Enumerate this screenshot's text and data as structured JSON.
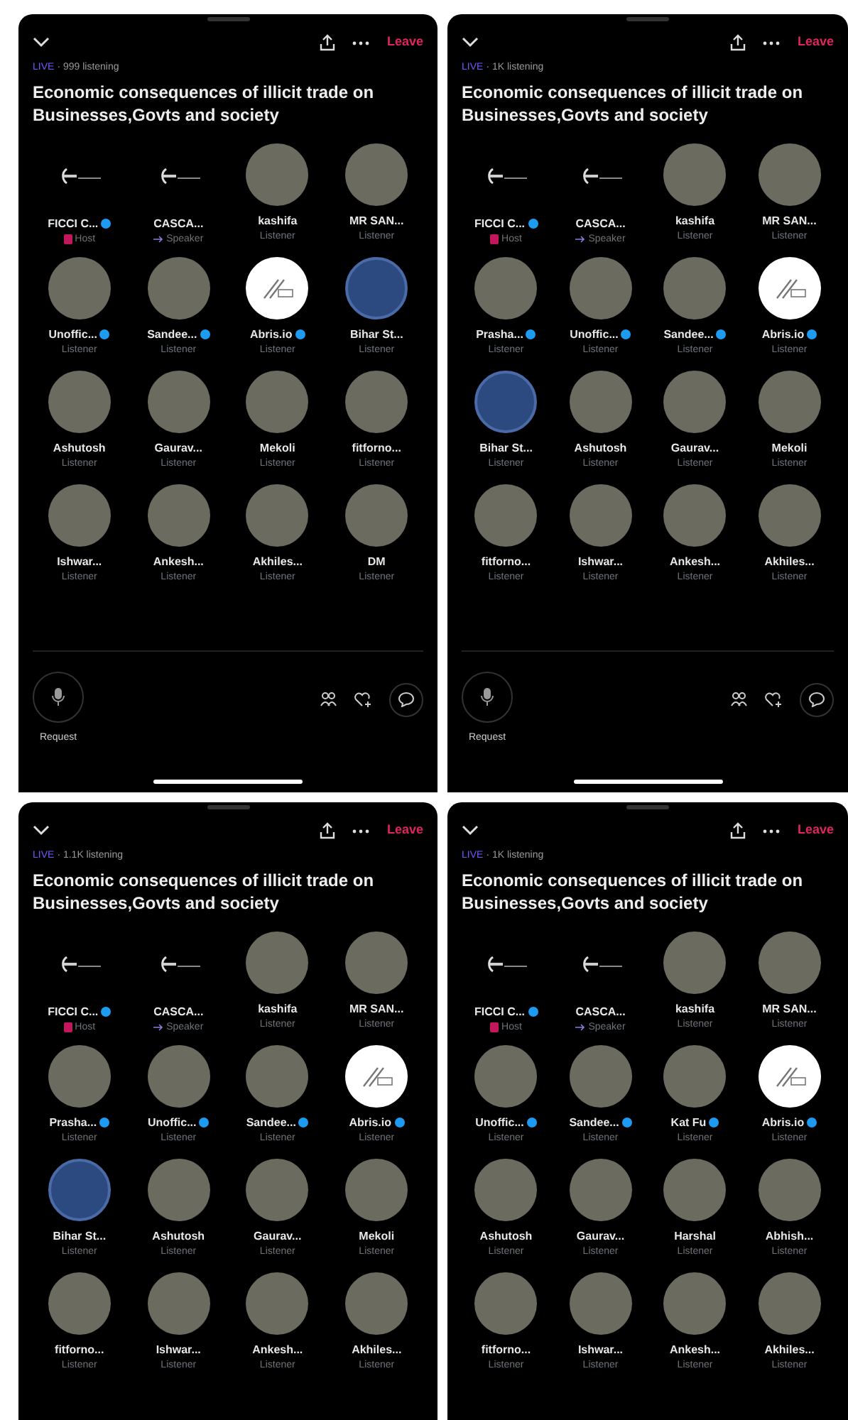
{
  "panels": [
    {
      "live": "LIVE",
      "listening": "· 999 listening",
      "leave": "Leave",
      "title": "Economic consequences of illicit trade on Businesses,Govts and society",
      "footer": {
        "request": "Request"
      },
      "participants": [
        {
          "name": "FICCI C...",
          "verified": true,
          "role": {
            "text": "Host",
            "kind": "host"
          },
          "kind": "logo"
        },
        {
          "name": "CASCA...",
          "verified": false,
          "role": {
            "text": "Speaker",
            "kind": "speaker"
          },
          "kind": "logo"
        },
        {
          "name": "kashifa",
          "verified": false,
          "role": {
            "text": "Listener",
            "kind": "listener"
          },
          "kind": "photo"
        },
        {
          "name": "MR SAN...",
          "verified": false,
          "role": {
            "text": "Listener",
            "kind": "listener"
          },
          "kind": "photo"
        },
        {
          "name": "Unoffic...",
          "verified": true,
          "role": {
            "text": "Listener",
            "kind": "listener"
          },
          "kind": "photo"
        },
        {
          "name": "Sandee...",
          "verified": true,
          "role": {
            "text": "Listener",
            "kind": "listener"
          },
          "kind": "photo"
        },
        {
          "name": "Abris.io",
          "verified": true,
          "role": {
            "text": "Listener",
            "kind": "listener"
          },
          "kind": "emblem"
        },
        {
          "name": "Bihar St...",
          "verified": false,
          "role": {
            "text": "Listener",
            "kind": "listener"
          },
          "kind": "globe"
        },
        {
          "name": "Ashutosh",
          "verified": false,
          "role": {
            "text": "Listener",
            "kind": "listener"
          },
          "kind": "photo"
        },
        {
          "name": "Gaurav...",
          "verified": false,
          "role": {
            "text": "Listener",
            "kind": "listener"
          },
          "kind": "photo"
        },
        {
          "name": "Mekoli",
          "verified": false,
          "role": {
            "text": "Listener",
            "kind": "listener"
          },
          "kind": "photo"
        },
        {
          "name": "fitforno...",
          "verified": false,
          "role": {
            "text": "Listener",
            "kind": "listener"
          },
          "kind": "photo"
        },
        {
          "name": "Ishwar...",
          "verified": false,
          "role": {
            "text": "Listener",
            "kind": "listener"
          },
          "kind": "photo"
        },
        {
          "name": "Ankesh...",
          "verified": false,
          "role": {
            "text": "Listener",
            "kind": "listener"
          },
          "kind": "photo"
        },
        {
          "name": "Akhiles...",
          "verified": false,
          "role": {
            "text": "Listener",
            "kind": "listener"
          },
          "kind": "photo"
        },
        {
          "name": "DM",
          "verified": false,
          "role": {
            "text": "Listener",
            "kind": "listener"
          },
          "kind": "photo"
        }
      ]
    },
    {
      "live": "LIVE",
      "listening": "· 1K listening",
      "leave": "Leave",
      "title": "Economic consequences of illicit trade on Businesses,Govts and society",
      "footer": {
        "request": "Request"
      },
      "participants": [
        {
          "name": "FICCI C...",
          "verified": true,
          "role": {
            "text": "Host",
            "kind": "host"
          },
          "kind": "logo"
        },
        {
          "name": "CASCA...",
          "verified": false,
          "role": {
            "text": "Speaker",
            "kind": "speaker"
          },
          "kind": "logo"
        },
        {
          "name": "kashifa",
          "verified": false,
          "role": {
            "text": "Listener",
            "kind": "listener"
          },
          "kind": "photo"
        },
        {
          "name": "MR SAN...",
          "verified": false,
          "role": {
            "text": "Listener",
            "kind": "listener"
          },
          "kind": "photo"
        },
        {
          "name": "Prasha...",
          "verified": true,
          "role": {
            "text": "Listener",
            "kind": "listener"
          },
          "kind": "photo"
        },
        {
          "name": "Unoffic...",
          "verified": true,
          "role": {
            "text": "Listener",
            "kind": "listener"
          },
          "kind": "photo"
        },
        {
          "name": "Sandee...",
          "verified": true,
          "role": {
            "text": "Listener",
            "kind": "listener"
          },
          "kind": "photo"
        },
        {
          "name": "Abris.io",
          "verified": true,
          "role": {
            "text": "Listener",
            "kind": "listener"
          },
          "kind": "emblem"
        },
        {
          "name": "Bihar St...",
          "verified": false,
          "role": {
            "text": "Listener",
            "kind": "listener"
          },
          "kind": "globe"
        },
        {
          "name": "Ashutosh",
          "verified": false,
          "role": {
            "text": "Listener",
            "kind": "listener"
          },
          "kind": "photo"
        },
        {
          "name": "Gaurav...",
          "verified": false,
          "role": {
            "text": "Listener",
            "kind": "listener"
          },
          "kind": "photo"
        },
        {
          "name": "Mekoli",
          "verified": false,
          "role": {
            "text": "Listener",
            "kind": "listener"
          },
          "kind": "photo"
        },
        {
          "name": "fitforno...",
          "verified": false,
          "role": {
            "text": "Listener",
            "kind": "listener"
          },
          "kind": "photo"
        },
        {
          "name": "Ishwar...",
          "verified": false,
          "role": {
            "text": "Listener",
            "kind": "listener"
          },
          "kind": "photo"
        },
        {
          "name": "Ankesh...",
          "verified": false,
          "role": {
            "text": "Listener",
            "kind": "listener"
          },
          "kind": "photo"
        },
        {
          "name": "Akhiles...",
          "verified": false,
          "role": {
            "text": "Listener",
            "kind": "listener"
          },
          "kind": "photo"
        }
      ]
    },
    {
      "live": "LIVE",
      "listening": "· 1.1K listening",
      "leave": "Leave",
      "title": "Economic consequences of illicit trade on Businesses,Govts and society",
      "participants": [
        {
          "name": "FICCI C...",
          "verified": true,
          "role": {
            "text": "Host",
            "kind": "host"
          },
          "kind": "logo"
        },
        {
          "name": "CASCA...",
          "verified": false,
          "role": {
            "text": "Speaker",
            "kind": "speaker"
          },
          "kind": "logo"
        },
        {
          "name": "kashifa",
          "verified": false,
          "role": {
            "text": "Listener",
            "kind": "listener"
          },
          "kind": "photo"
        },
        {
          "name": "MR SAN...",
          "verified": false,
          "role": {
            "text": "Listener",
            "kind": "listener"
          },
          "kind": "photo"
        },
        {
          "name": "Prasha...",
          "verified": true,
          "role": {
            "text": "Listener",
            "kind": "listener"
          },
          "kind": "photo"
        },
        {
          "name": "Unoffic...",
          "verified": true,
          "role": {
            "text": "Listener",
            "kind": "listener"
          },
          "kind": "photo"
        },
        {
          "name": "Sandee...",
          "verified": true,
          "role": {
            "text": "Listener",
            "kind": "listener"
          },
          "kind": "photo"
        },
        {
          "name": "Abris.io",
          "verified": true,
          "role": {
            "text": "Listener",
            "kind": "listener"
          },
          "kind": "emblem"
        },
        {
          "name": "Bihar St...",
          "verified": false,
          "role": {
            "text": "Listener",
            "kind": "listener"
          },
          "kind": "globe"
        },
        {
          "name": "Ashutosh",
          "verified": false,
          "role": {
            "text": "Listener",
            "kind": "listener"
          },
          "kind": "photo"
        },
        {
          "name": "Gaurav...",
          "verified": false,
          "role": {
            "text": "Listener",
            "kind": "listener"
          },
          "kind": "photo"
        },
        {
          "name": "Mekoli",
          "verified": false,
          "role": {
            "text": "Listener",
            "kind": "listener"
          },
          "kind": "photo"
        },
        {
          "name": "fitforno...",
          "verified": false,
          "role": {
            "text": "Listener",
            "kind": "listener"
          },
          "kind": "photo"
        },
        {
          "name": "Ishwar...",
          "verified": false,
          "role": {
            "text": "Listener",
            "kind": "listener"
          },
          "kind": "photo"
        },
        {
          "name": "Ankesh...",
          "verified": false,
          "role": {
            "text": "Listener",
            "kind": "listener"
          },
          "kind": "photo"
        },
        {
          "name": "Akhiles...",
          "verified": false,
          "role": {
            "text": "Listener",
            "kind": "listener"
          },
          "kind": "photo"
        }
      ]
    },
    {
      "live": "LIVE",
      "listening": "· 1K listening",
      "leave": "Leave",
      "title": "Economic consequences of illicit trade on Businesses,Govts and society",
      "participants": [
        {
          "name": "FICCI C...",
          "verified": true,
          "role": {
            "text": "Host",
            "kind": "host"
          },
          "kind": "logo"
        },
        {
          "name": "CASCA...",
          "verified": false,
          "role": {
            "text": "Speaker",
            "kind": "speaker"
          },
          "kind": "logo"
        },
        {
          "name": "kashifa",
          "verified": false,
          "role": {
            "text": "Listener",
            "kind": "listener"
          },
          "kind": "photo"
        },
        {
          "name": "MR SAN...",
          "verified": false,
          "role": {
            "text": "Listener",
            "kind": "listener"
          },
          "kind": "photo"
        },
        {
          "name": "Unoffic...",
          "verified": true,
          "role": {
            "text": "Listener",
            "kind": "listener"
          },
          "kind": "photo"
        },
        {
          "name": "Sandee...",
          "verified": true,
          "role": {
            "text": "Listener",
            "kind": "listener"
          },
          "kind": "photo"
        },
        {
          "name": "Kat Fu",
          "verified": true,
          "role": {
            "text": "Listener",
            "kind": "listener"
          },
          "kind": "photo"
        },
        {
          "name": "Abris.io",
          "verified": true,
          "role": {
            "text": "Listener",
            "kind": "listener"
          },
          "kind": "emblem"
        },
        {
          "name": "Ashutosh",
          "verified": false,
          "role": {
            "text": "Listener",
            "kind": "listener"
          },
          "kind": "photo"
        },
        {
          "name": "Gaurav...",
          "verified": false,
          "role": {
            "text": "Listener",
            "kind": "listener"
          },
          "kind": "photo"
        },
        {
          "name": "Harshal",
          "verified": false,
          "role": {
            "text": "Listener",
            "kind": "listener"
          },
          "kind": "photo"
        },
        {
          "name": "Abhish...",
          "verified": false,
          "role": {
            "text": "Listener",
            "kind": "listener"
          },
          "kind": "photo"
        },
        {
          "name": "fitforno...",
          "verified": false,
          "role": {
            "text": "Listener",
            "kind": "listener"
          },
          "kind": "photo"
        },
        {
          "name": "Ishwar...",
          "verified": false,
          "role": {
            "text": "Listener",
            "kind": "listener"
          },
          "kind": "photo"
        },
        {
          "name": "Ankesh...",
          "verified": false,
          "role": {
            "text": "Listener",
            "kind": "listener"
          },
          "kind": "photo"
        },
        {
          "name": "Akhiles...",
          "verified": false,
          "role": {
            "text": "Listener",
            "kind": "listener"
          },
          "kind": "photo"
        }
      ]
    }
  ]
}
